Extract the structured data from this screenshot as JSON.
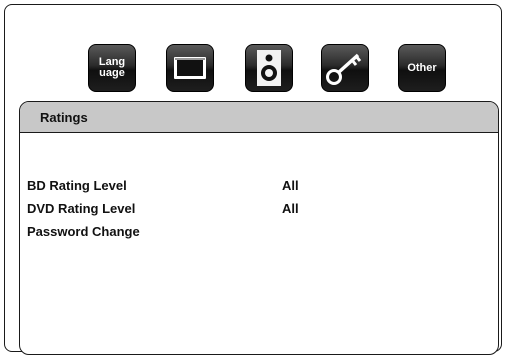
{
  "toolbar": {
    "language_label_line1": "Lang",
    "language_label_line2": "uage",
    "other_label": "Other",
    "icons": [
      "language-icon",
      "display-icon",
      "speaker-icon",
      "key-icon",
      "other-icon"
    ]
  },
  "panel": {
    "title": "Ratings",
    "items": [
      {
        "label": "BD Rating Level",
        "value": "All"
      },
      {
        "label": "DVD Rating Level",
        "value": "All"
      },
      {
        "label": "Password Change",
        "value": ""
      }
    ]
  },
  "colors": {
    "header_bg": "#c8c8c8",
    "icon_bg": "#1e1e1e"
  }
}
